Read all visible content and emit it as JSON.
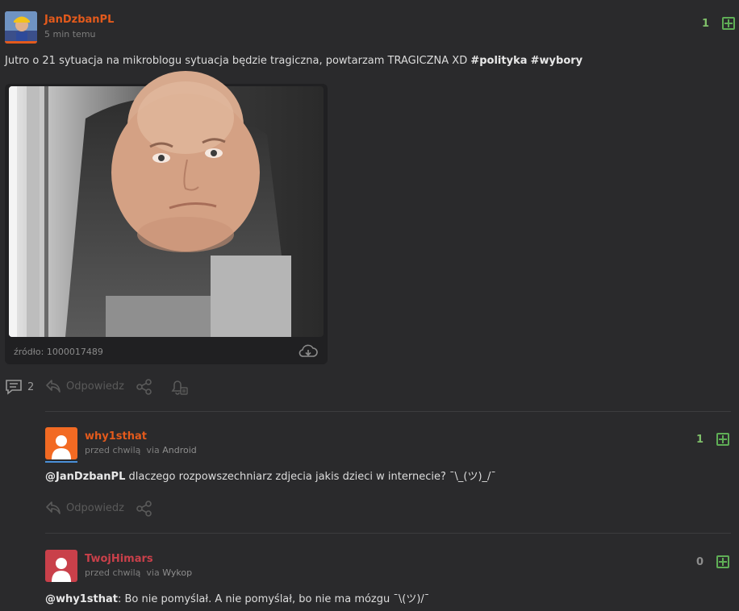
{
  "post": {
    "author": "JanDzbanPL",
    "time": "5 min temu",
    "votes": "1",
    "text": "Jutro o 21 sytuacja na mikroblogu sytuacja będzie tragiczna, powtarzam TRAGICZNA XD ",
    "tags": [
      "#polityka",
      "#wybory"
    ],
    "image_source": "źródło: 1000017489",
    "comment_count": "2",
    "reply_label": "Odpowiedz"
  },
  "comments": [
    {
      "author": "why1sthat",
      "time": "przed chwilą",
      "via_prefix": "via",
      "via": "Android",
      "votes": "1",
      "mention": "@JanDzbanPL",
      "text": " dlaczego rozpowszechniarz zdjecia jakis dzieci w internecie? ¯\\_(ツ)_/¯",
      "reply_label": "Odpowiedz",
      "avatar_color": "#f26a23"
    },
    {
      "author": "TwojHimars",
      "time": "przed chwilą",
      "via_prefix": "via",
      "via": "Wykop",
      "votes": "0",
      "mention": "@why1sthat",
      "text": ": Bo nie pomyślał. A nie pomyślał, bo nie ma mózgu ¯\\(ツ)/¯",
      "avatar_color": "#c9404a"
    }
  ],
  "colors": {
    "background": "#2a2a2c",
    "username_orange": "#e35a1c",
    "username_red": "#c9404a",
    "vote_green": "#5fae56"
  }
}
